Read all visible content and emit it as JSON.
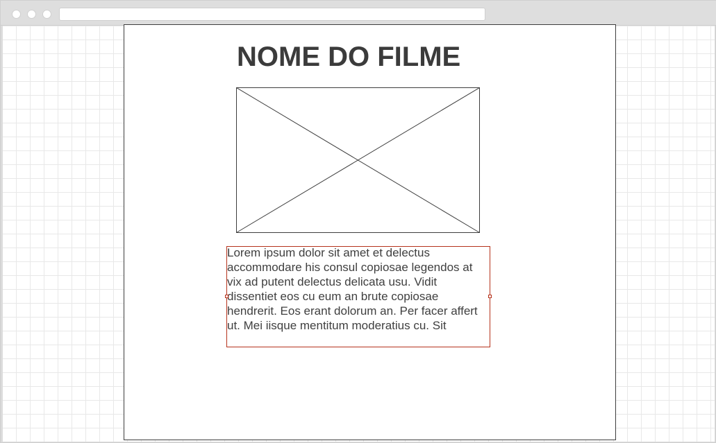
{
  "mockup": {
    "title": "NOME DO FILME",
    "image_placeholder_icon": "image-placeholder-icon",
    "body_text": "Lorem ipsum dolor sit amet et delectus accommodare his consul copiosae legendos at vix ad putent delectus delicata usu. Vidit dissentiet eos cu eum an brute copiosae hendrerit. Eos erant dolorum an. Per facer affert ut. Mei iisque mentitum moderatius cu. Sit"
  },
  "colors": {
    "frame_border": "#3d3d3d",
    "selection": "#b5311a",
    "text": "#3f3f3f",
    "grid": "#e8e8e8"
  }
}
